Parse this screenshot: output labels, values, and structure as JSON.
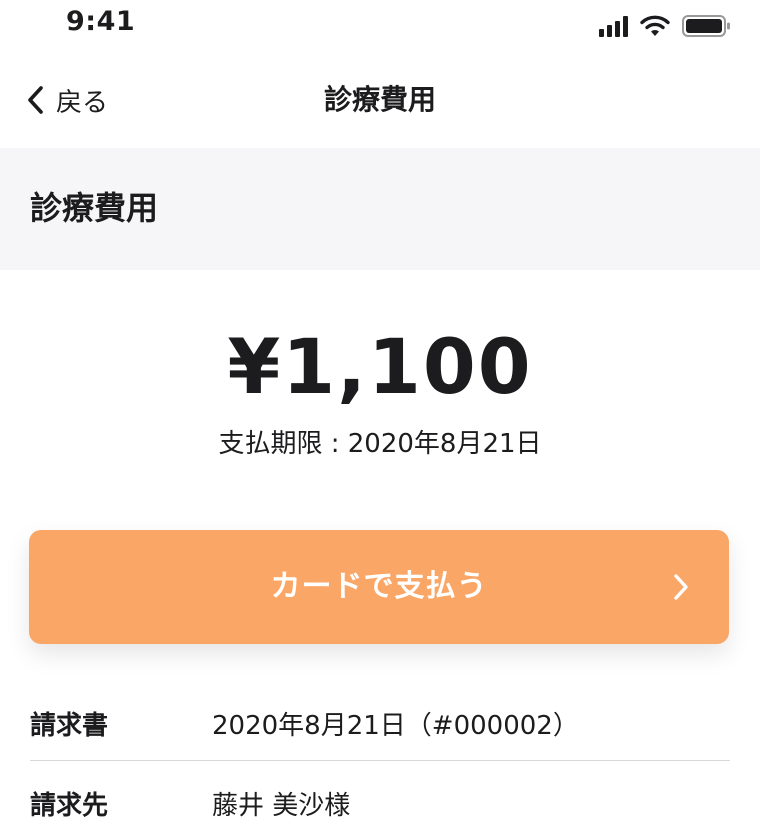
{
  "status_bar": {
    "time": "9:41",
    "icons": [
      "cellular-signal-icon",
      "wifi-icon",
      "battery-icon"
    ]
  },
  "nav": {
    "back_label": "戻る",
    "back_icon": "chevron-left-icon",
    "title": "診療費用"
  },
  "section": {
    "title": "診療費用"
  },
  "payment": {
    "amount": "¥1,100",
    "due_label": "支払期限",
    "due_date": "2020年8月21日",
    "pay_button_label": "カードで支払う",
    "pay_button_icon": "chevron-right-icon"
  },
  "details": [
    {
      "label": "請求書",
      "value": "2020年8月21日（#000002）"
    },
    {
      "label": "請求先",
      "value": "藤井 美沙様"
    }
  ],
  "colors": {
    "accent": "#faa666",
    "section_background": "#f6f6f8",
    "text": "#1c1c1e",
    "divider": "#d8d8da"
  }
}
